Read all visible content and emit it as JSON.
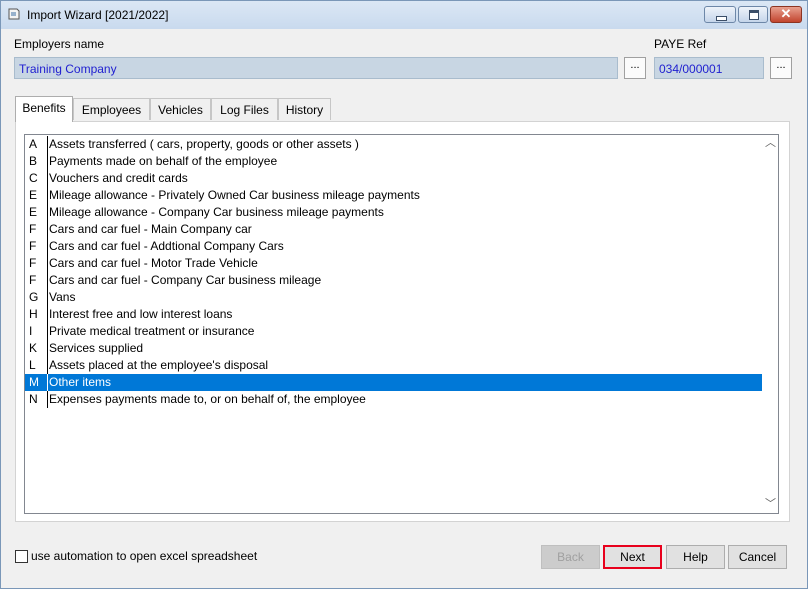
{
  "window": {
    "title": "Import Wizard [2021/2022]"
  },
  "employer": {
    "label": "Employers name",
    "value": "Training Company",
    "browse": "..."
  },
  "paye": {
    "label": "PAYE Ref",
    "value": "034/000001",
    "browse": "..."
  },
  "tabs": [
    "Benefits",
    "Employees",
    "Vehicles",
    "Log Files",
    "History"
  ],
  "active_tab": "Benefits",
  "benefits": [
    {
      "code": "A",
      "desc": "Assets transferred ( cars, property, goods or other assets )"
    },
    {
      "code": "B",
      "desc": "Payments made on behalf of the employee"
    },
    {
      "code": "C",
      "desc": "Vouchers and credit cards"
    },
    {
      "code": "E",
      "desc": "Mileage allowance - Privately Owned Car business mileage payments"
    },
    {
      "code": "E",
      "desc": "Mileage allowance - Company Car business mileage payments"
    },
    {
      "code": "F",
      "desc": "Cars and car fuel - Main Company car"
    },
    {
      "code": "F",
      "desc": "Cars and car fuel - Addtional Company Cars"
    },
    {
      "code": "F",
      "desc": "Cars and car fuel - Motor Trade Vehicle"
    },
    {
      "code": "F",
      "desc": "Cars and car fuel - Company Car business mileage"
    },
    {
      "code": "G",
      "desc": "Vans"
    },
    {
      "code": "H",
      "desc": "Interest free and low interest loans"
    },
    {
      "code": "I",
      "desc": "Private medical treatment or insurance"
    },
    {
      "code": "K",
      "desc": "Services supplied"
    },
    {
      "code": "L",
      "desc": "Assets placed at the employee's disposal"
    },
    {
      "code": "M",
      "desc": "Other items"
    },
    {
      "code": "N",
      "desc": "Expenses payments made to, or on behalf of, the employee"
    }
  ],
  "selected_index": 14,
  "automation": {
    "label": "use automation to open excel spreadsheet",
    "checked": false
  },
  "buttons": {
    "back": "Back",
    "next": "Next",
    "help": "Help",
    "cancel": "Cancel"
  }
}
